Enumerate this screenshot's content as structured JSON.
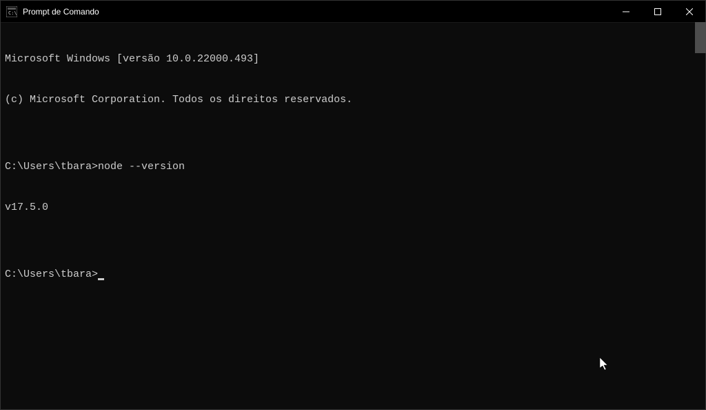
{
  "window": {
    "title": "Prompt de Comando"
  },
  "terminal": {
    "line1": "Microsoft Windows [versão 10.0.22000.493]",
    "line2": "(c) Microsoft Corporation. Todos os direitos reservados.",
    "blank1": "",
    "prompt1": "C:\\Users\\tbara>",
    "command1": "node --version",
    "output1": "v17.5.0",
    "blank2": "",
    "prompt2": "C:\\Users\\tbara>"
  }
}
